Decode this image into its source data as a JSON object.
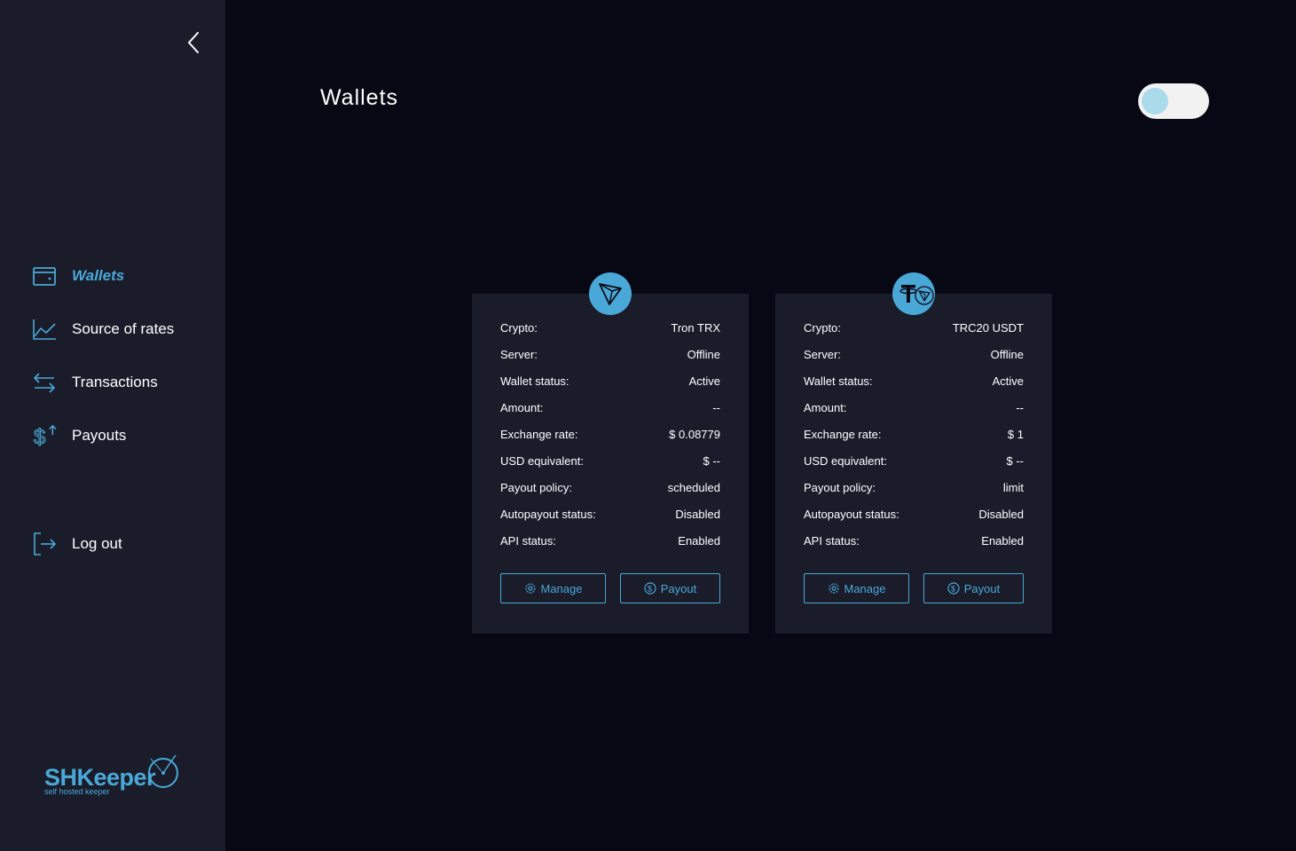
{
  "sidebar": {
    "items": [
      {
        "label": "Wallets",
        "icon": "wallet-icon",
        "active": true
      },
      {
        "label": "Source of rates",
        "icon": "chart-line-icon"
      },
      {
        "label": "Transactions",
        "icon": "transfer-arrows-icon"
      },
      {
        "label": "Payouts",
        "icon": "dollar-up-icon"
      }
    ],
    "logout": {
      "label": "Log out",
      "icon": "logout-icon"
    },
    "logo": {
      "name": "SHKeeper",
      "tagline": "self hosted keeper"
    }
  },
  "header": {
    "title": "Wallets",
    "theme_toggle_on": false
  },
  "wallets": [
    {
      "coin_icon": "tron-icon",
      "rows": [
        {
          "label": "Crypto:",
          "value": "Tron TRX"
        },
        {
          "label": "Server:",
          "value": "Offline"
        },
        {
          "label": "Wallet status:",
          "value": "Active"
        },
        {
          "label": "Amount:",
          "value": "--"
        },
        {
          "label": "Exchange rate:",
          "value": "$  0.08779"
        },
        {
          "label": "USD equivalent:",
          "value": "$  --"
        },
        {
          "label": "Payout policy:",
          "value": "scheduled"
        },
        {
          "label": "Autopayout status:",
          "value": "Disabled"
        },
        {
          "label": "API status:",
          "value": "Enabled"
        }
      ],
      "manage_label": "Manage",
      "payout_label": "Payout"
    },
    {
      "coin_icon": "tether-tron-icon",
      "rows": [
        {
          "label": "Crypto:",
          "value": "TRC20 USDT"
        },
        {
          "label": "Server:",
          "value": "Offline"
        },
        {
          "label": "Wallet status:",
          "value": "Active"
        },
        {
          "label": "Amount:",
          "value": "--"
        },
        {
          "label": "Exchange rate:",
          "value": "$  1"
        },
        {
          "label": "USD equivalent:",
          "value": "$  --"
        },
        {
          "label": "Payout policy:",
          "value": "limit"
        },
        {
          "label": "Autopayout status:",
          "value": "Disabled"
        },
        {
          "label": "API status:",
          "value": "Enabled"
        }
      ],
      "manage_label": "Manage",
      "payout_label": "Payout"
    }
  ],
  "colors": {
    "accent": "#4aa8d8",
    "status_green": "#33b3a0",
    "status_magenta": "#c338e8",
    "sidebar_bg": "#1a1c2a",
    "page_bg": "#080814"
  }
}
